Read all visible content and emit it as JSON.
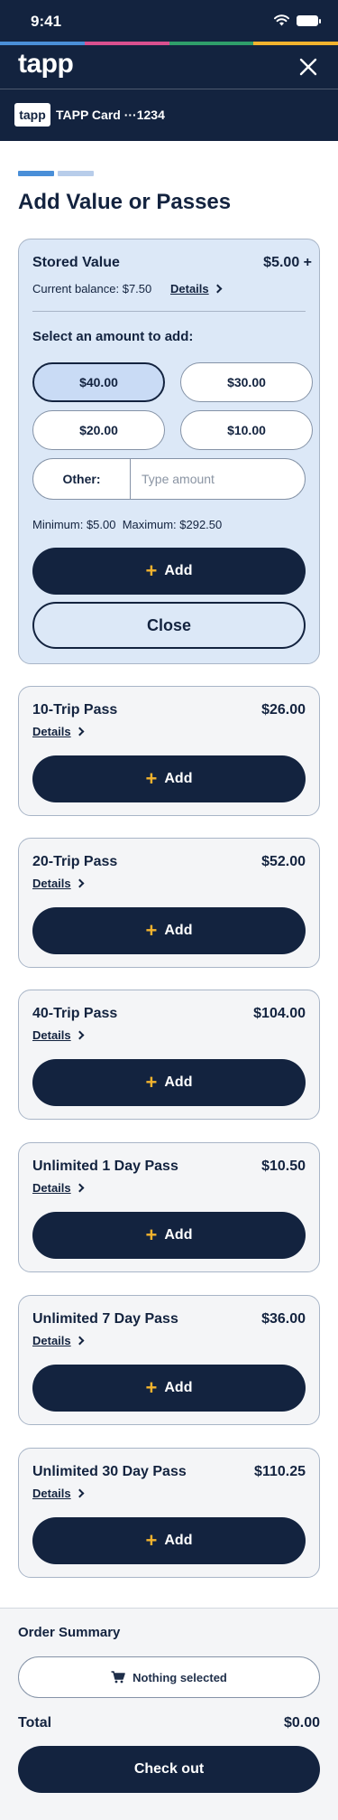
{
  "status_bar": {
    "time": "9:41"
  },
  "brand": {
    "logo": "tapp",
    "stripe_colors": [
      "#4a8fd8",
      "#d9508f",
      "#2f9e6a",
      "#f2b32e"
    ]
  },
  "card": {
    "badge": "tapp",
    "name": "TAPP Card ···1234"
  },
  "page": {
    "title": "Add Value or Passes",
    "step": 1,
    "step_count": 2
  },
  "stored_value": {
    "title": "Stored Value",
    "price": "$5.00 +",
    "balance": "Current balance: $7.50",
    "details": "Details",
    "select_label": "Select an amount to add:",
    "amounts": [
      "$40.00",
      "$30.00",
      "$20.00",
      "$10.00"
    ],
    "selected": "$40.00",
    "other_label": "Other:",
    "other_placeholder": "Type amount",
    "limits": "Minimum: $5.00  Maximum: $292.50",
    "add_label": "Add",
    "close_label": "Close"
  },
  "passes": [
    {
      "name": "10-Trip Pass",
      "price": "$26.00",
      "details": "Details",
      "add": "Add"
    },
    {
      "name": "20-Trip Pass",
      "price": "$52.00",
      "details": "Details",
      "add": "Add"
    },
    {
      "name": "40-Trip Pass",
      "price": "$104.00",
      "details": "Details",
      "add": "Add"
    },
    {
      "name": "Unlimited 1 Day Pass",
      "price": "$10.50",
      "details": "Details",
      "add": "Add"
    },
    {
      "name": "Unlimited 7 Day Pass",
      "price": "$36.00",
      "details": "Details",
      "add": "Add"
    },
    {
      "name": "Unlimited 30 Day Pass",
      "price": "$110.25",
      "details": "Details",
      "add": "Add"
    }
  ],
  "summary": {
    "title": "Order Summary",
    "empty": "Nothing selected",
    "total_label": "Total",
    "total_value": "$0.00",
    "checkout": "Check out"
  },
  "icons": [
    "wifi-icon",
    "battery-icon",
    "close-icon",
    "chevron-right-icon",
    "plus-icon",
    "cart-icon"
  ]
}
